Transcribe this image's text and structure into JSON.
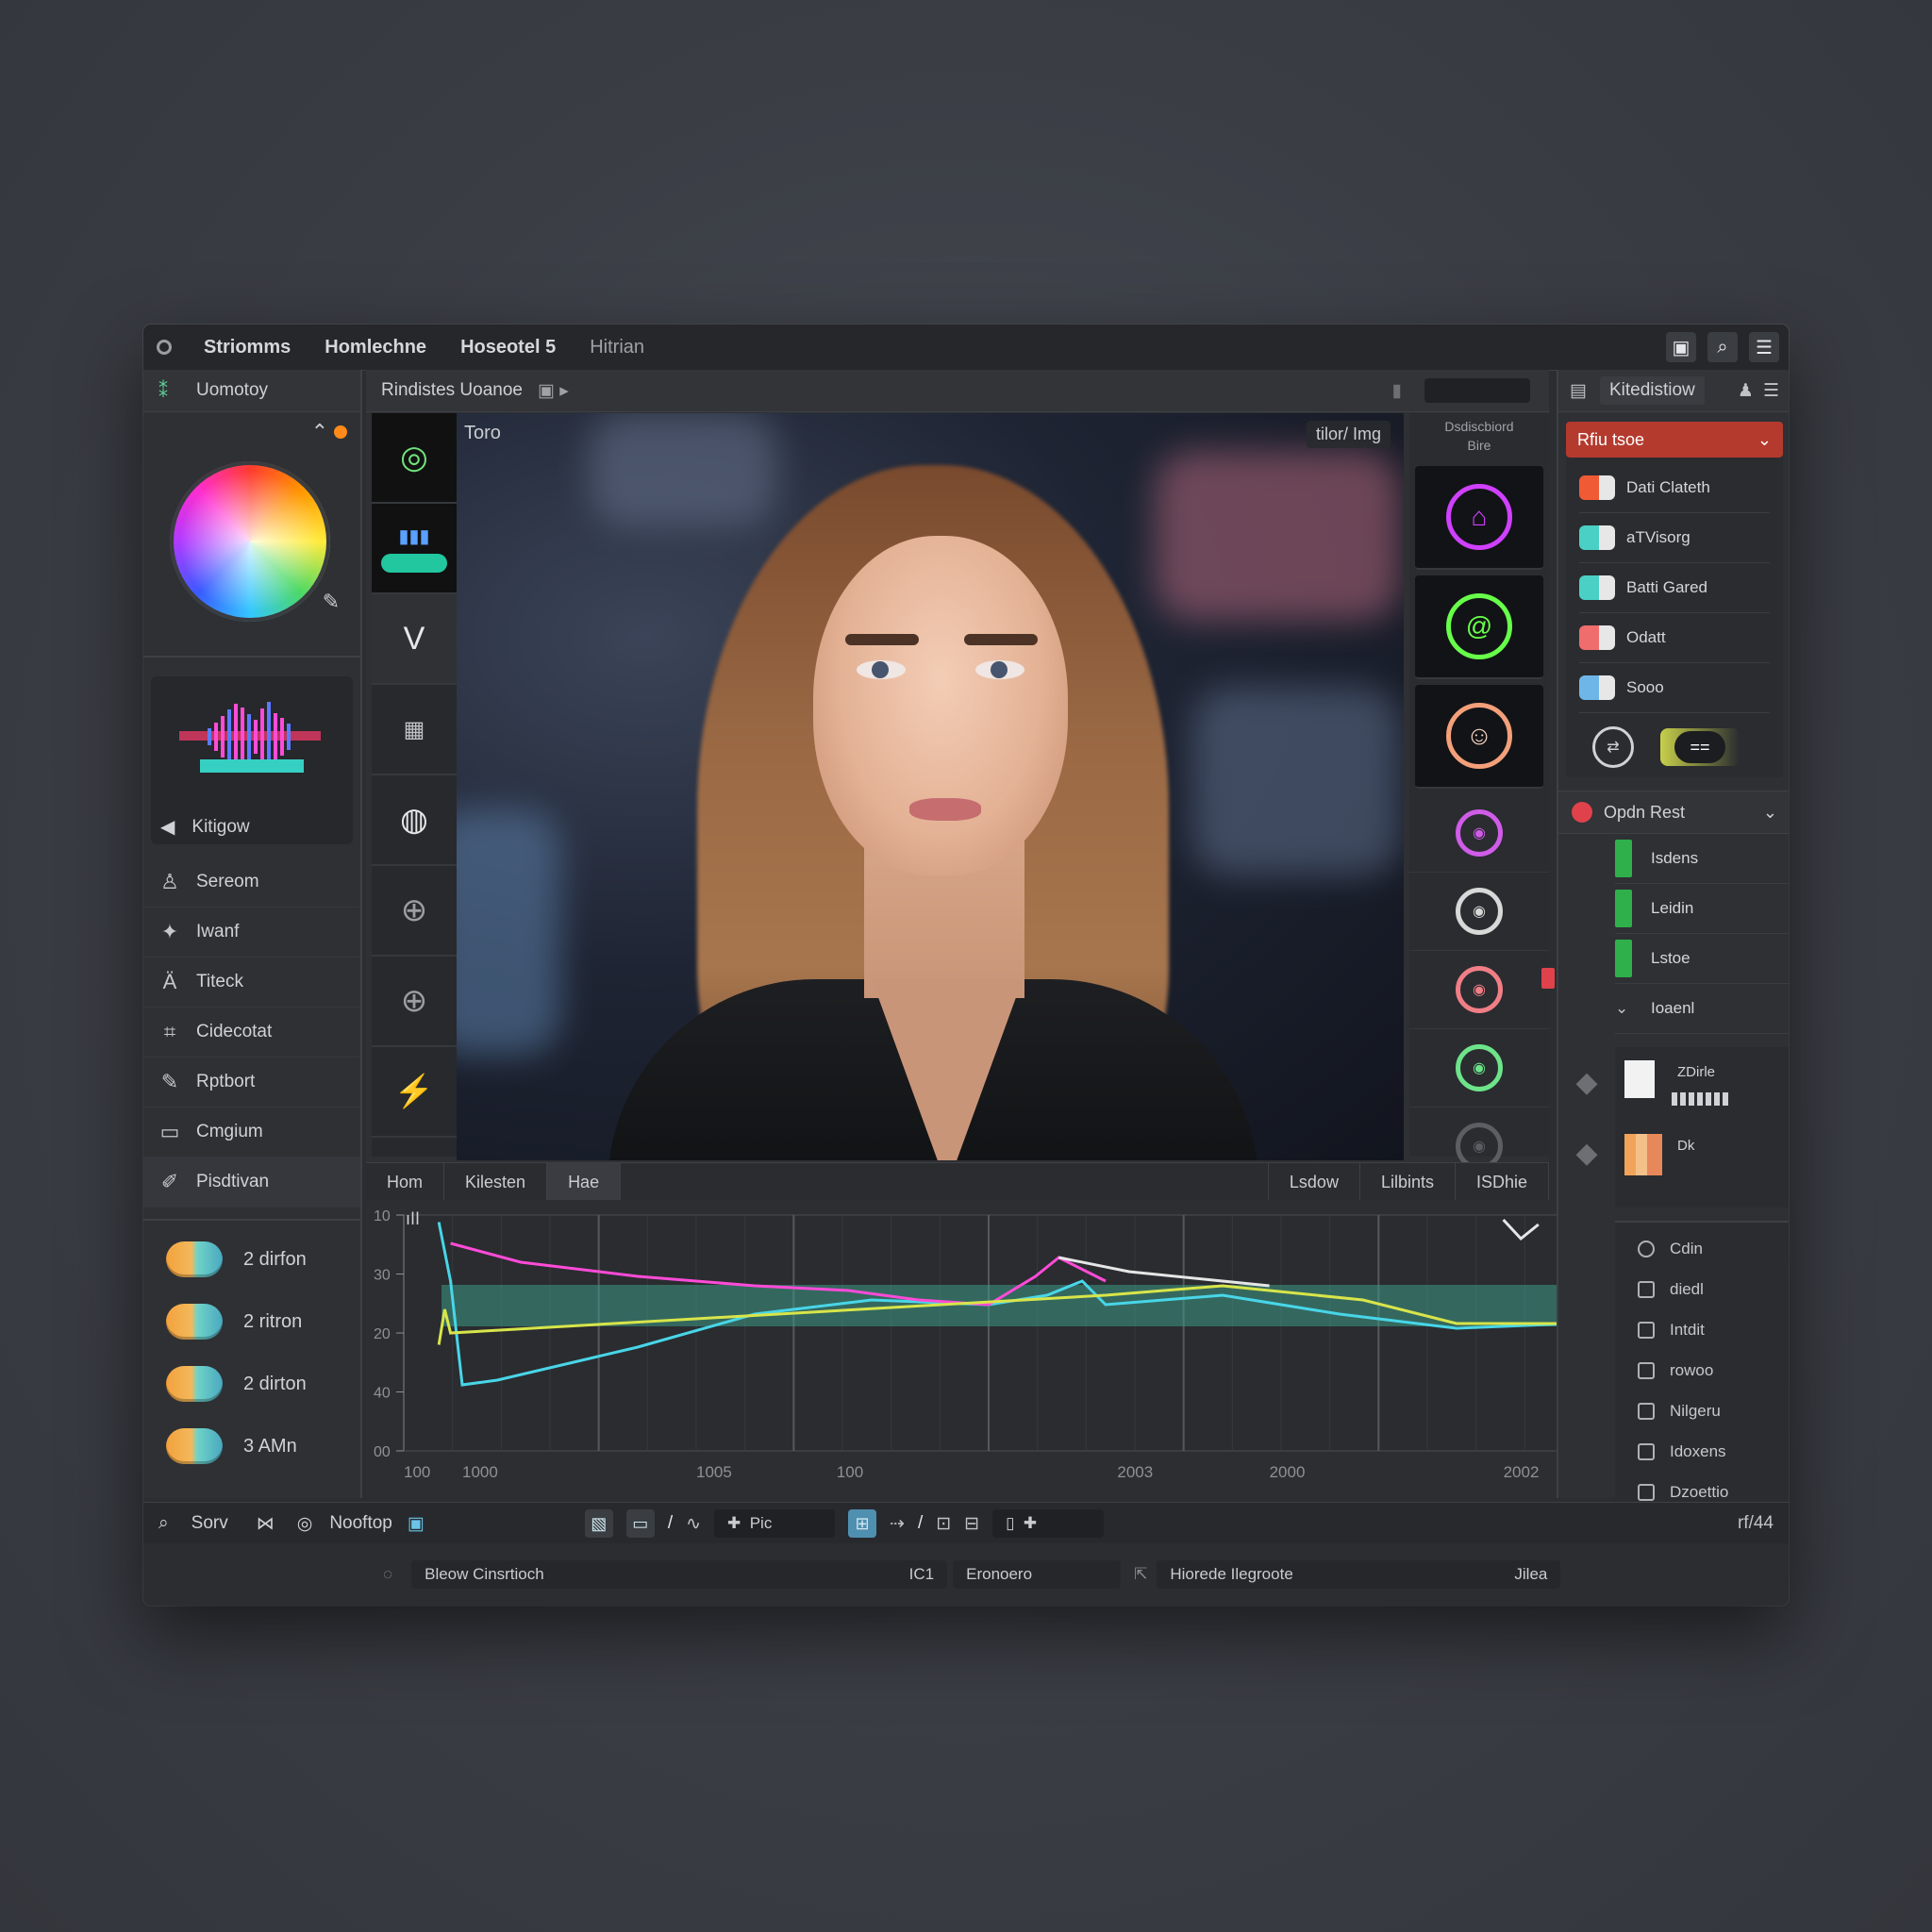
{
  "titlebar": {
    "menus": [
      "Striomms",
      "Homlechne",
      "Hoseotel 5",
      "Hitrian"
    ],
    "buttons": [
      "window-icon",
      "search-icon",
      "menu-icon"
    ]
  },
  "left": {
    "header": "Uomotoy",
    "wave_label": "Kitigow",
    "tools": [
      {
        "label": "Sereom",
        "icon": "figure-icon"
      },
      {
        "label": "Iwanf",
        "icon": "wand-icon"
      },
      {
        "label": "Titeck",
        "icon": "text-icon"
      },
      {
        "label": "Cidecotat",
        "icon": "crop-icon"
      },
      {
        "label": "Rptbort",
        "icon": "brush-icon"
      },
      {
        "label": "Cmgium",
        "icon": "layout-icon"
      },
      {
        "label": "Pisdtivan",
        "icon": "pencil-icon"
      }
    ],
    "clips": [
      "2 dirfon",
      "2 ritron",
      "2 dirton",
      "3 AMn"
    ]
  },
  "center": {
    "header": "Rindistes Uoanoe",
    "photo_title": "Toro",
    "photo_badge": "tilor/ Img",
    "fx_header_line1": "Dsdiscbiord",
    "fx_header_line2": "Bire",
    "tabs_left": [
      "Hom",
      "Kilesten",
      "Hae"
    ],
    "tabs_right": [
      "Lsdow",
      "Lilbints",
      "ISDhie"
    ]
  },
  "graph": {
    "y_ticks": [
      "10",
      "30",
      "20",
      "40",
      "00"
    ],
    "x_ticks": [
      "100",
      "1000",
      "1005",
      "100",
      "2003",
      "2000",
      "2002"
    ],
    "colors": {
      "magenta": "#ff4bd8",
      "cyan": "#48d6e8",
      "yellow": "#d8e54a",
      "white": "#e6e6e6",
      "band": "#3c9a86"
    }
  },
  "right": {
    "header": "Kitedistiow",
    "dropdown": "Rfiu tsoe",
    "layers": [
      {
        "label": "Dati Clateth",
        "color": "#f05a34"
      },
      {
        "label": "aTVisorg",
        "color": "#4ad0c4"
      },
      {
        "label": "Batti Gared",
        "color": "#4ad0c4"
      },
      {
        "label": "Odatt",
        "color": "#ef6d6d"
      },
      {
        "label": "Sooo",
        "color": "#6fb6e8"
      }
    ],
    "bar2_label": "Opdn Rest",
    "groups": [
      "Isdens",
      "Leidin",
      "Lstoe",
      "Ioaenl"
    ],
    "thumb_labels": [
      "ZDirle",
      "Dk"
    ],
    "checks": [
      "Cdin",
      "diedl",
      "Intdit",
      "rowoo",
      "Nilgeru",
      "Idoxens",
      "Dzoettio"
    ]
  },
  "bottom": {
    "search_label": "Sorv",
    "tool_label": "Nooftop",
    "field1": "Pic",
    "status_left": "Bleow Cinsrtioch",
    "status_mid_a": "IC1",
    "status_mid_b": "Eronoero",
    "status_right": "Hiorede Ilegroote",
    "status_end": "Jilea",
    "corner": "rf/44"
  }
}
